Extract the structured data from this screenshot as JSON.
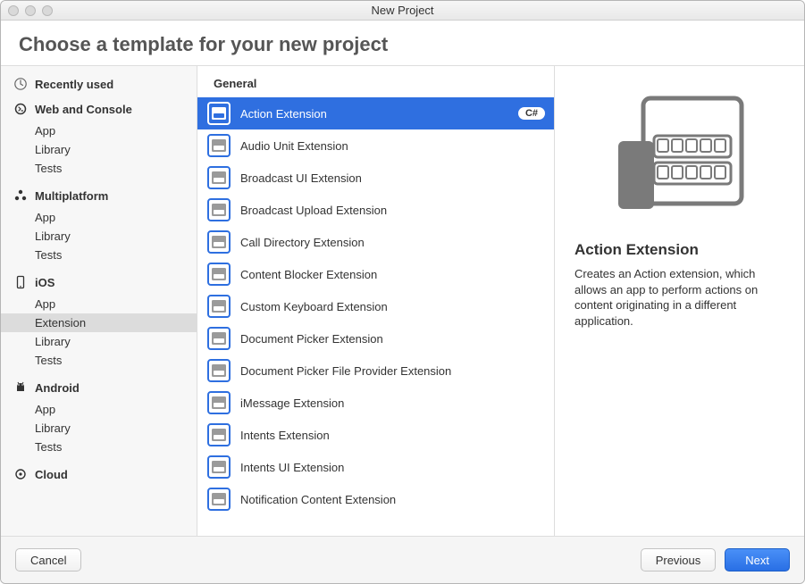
{
  "window": {
    "title": "New Project"
  },
  "header": {
    "heading": "Choose a template for your new project"
  },
  "sidebar": {
    "recent": {
      "label": "Recently used"
    },
    "sections": [
      {
        "heading": "Web and Console",
        "items": [
          "App",
          "Library",
          "Tests"
        ],
        "icon": "console"
      },
      {
        "heading": "Multiplatform",
        "items": [
          "App",
          "Library",
          "Tests"
        ],
        "icon": "tri"
      },
      {
        "heading": "iOS",
        "items": [
          "App",
          "Extension",
          "Library",
          "Tests"
        ],
        "icon": "phone",
        "selected": "Extension"
      },
      {
        "heading": "Android",
        "items": [
          "App",
          "Library",
          "Tests"
        ],
        "icon": "android"
      },
      {
        "heading": "Cloud",
        "items": [],
        "icon": "cloud"
      }
    ]
  },
  "templates": {
    "group": "General",
    "items": [
      {
        "label": "Action Extension",
        "selected": true,
        "lang": "C#"
      },
      {
        "label": "Audio Unit Extension"
      },
      {
        "label": "Broadcast UI Extension"
      },
      {
        "label": "Broadcast Upload Extension"
      },
      {
        "label": "Call Directory Extension"
      },
      {
        "label": "Content Blocker Extension"
      },
      {
        "label": "Custom Keyboard Extension"
      },
      {
        "label": "Document Picker Extension"
      },
      {
        "label": "Document Picker File Provider Extension"
      },
      {
        "label": "iMessage Extension"
      },
      {
        "label": "Intents Extension"
      },
      {
        "label": "Intents UI Extension"
      },
      {
        "label": "Notification Content Extension"
      }
    ]
  },
  "detail": {
    "title": "Action Extension",
    "desc": "Creates an Action extension, which allows an app to perform actions on content originating in a different application."
  },
  "footer": {
    "cancel": "Cancel",
    "previous": "Previous",
    "next": "Next"
  }
}
